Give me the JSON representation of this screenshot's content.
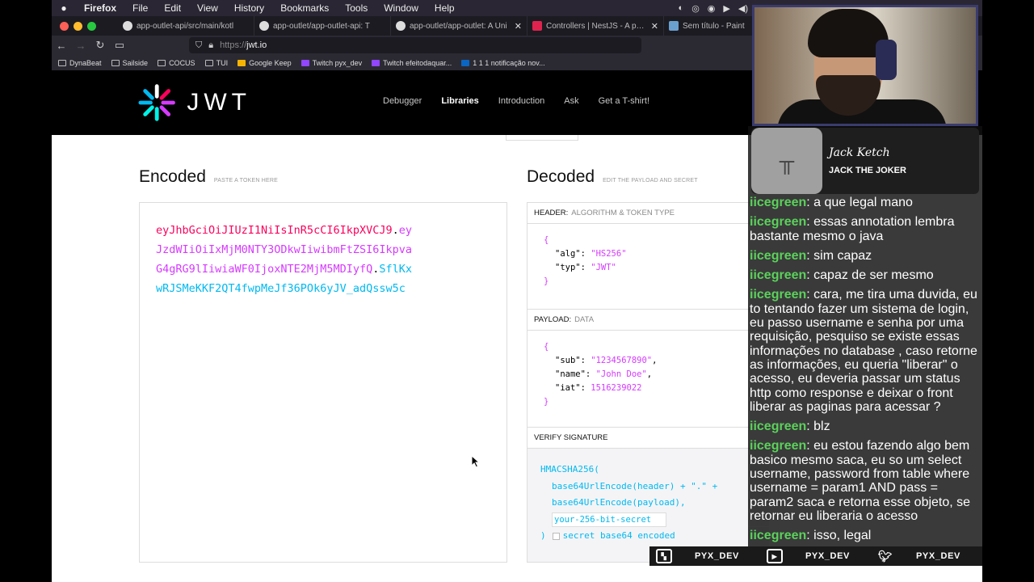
{
  "menubar": {
    "app": "Firefox",
    "items": [
      "File",
      "Edit",
      "View",
      "History",
      "Bookmarks",
      "Tools",
      "Window",
      "Help"
    ]
  },
  "tabs": [
    {
      "label": "app-outlet-api/src/main/kotl",
      "icon": "github-icon"
    },
    {
      "label": "app-outlet/app-outlet-api: T",
      "icon": "github-icon"
    },
    {
      "label": "app-outlet/app-outlet: A Uni",
      "icon": "github-icon"
    },
    {
      "label": "Controllers | NestJS - A prog",
      "icon": "nestjs-icon"
    },
    {
      "label": "Sem título - Paint",
      "icon": "paint-icon"
    }
  ],
  "address": {
    "scheme": "https://",
    "host": "jwt.io"
  },
  "bookmarks": [
    "DynaBeat",
    "Sailside",
    "COCUS",
    "TUI",
    "Google Keep",
    "Twitch pyx_dev",
    "Twitch efeitodaquar...",
    "1 1 1 notificação nov..."
  ],
  "site": {
    "logo_text": "JWT",
    "nav": [
      "Debugger",
      "Libraries",
      "Introduction",
      "Ask",
      "Get a T-shirt!"
    ],
    "active_nav": "Libraries"
  },
  "encoded": {
    "title": "Encoded",
    "hint": "PASTE A TOKEN HERE",
    "lines": [
      {
        "h": "eyJhbGciOiJIUzI1NiIsInR5cCI6IkpXVCJ9",
        "dot": ".",
        "p": "ey"
      },
      {
        "p": "JzdWIiOiIxMjM0NTY3ODkwIiwibmFtZSI6Ikpva"
      },
      {
        "p": "G4gRG9lIiwiaWF0IjoxNTE2MjM5MDIyfQ",
        "dot": ".",
        "s": "SflKx"
      },
      {
        "s": "wRJSMeKKF2QT4fwpMeJf36POk6yJV_adQssw5c"
      }
    ]
  },
  "decoded": {
    "title": "Decoded",
    "hint": "EDIT THE PAYLOAD AND SECRET",
    "header_label": "HEADER:",
    "header_sub": "ALGORITHM & TOKEN TYPE",
    "header_json": {
      "alg": "HS256",
      "typ": "JWT"
    },
    "payload_label": "PAYLOAD:",
    "payload_sub": "DATA",
    "payload_json": {
      "sub": "1234567890",
      "name": "John Doe",
      "iat": "1516239022"
    },
    "verify_label": "VERIFY SIGNATURE",
    "sig_fn": "HMACSHA256(",
    "sig_line1": "base64UrlEncode(header) + \".\" +",
    "sig_line2": "base64UrlEncode(payload),",
    "secret_value": "your-256-bit-secret",
    "sig_close": ")",
    "secret_b64_label": "secret base64 encoded"
  },
  "alert": {
    "name": "Jack Ketch",
    "subtitle": "JACK THE JOKER"
  },
  "chat": [
    {
      "user": "iicegreen",
      "text": "a que legal mano"
    },
    {
      "user": "iicegreen",
      "text": "essas annotation lembra bastante mesmo o java"
    },
    {
      "user": "iicegreen",
      "text": "sim capaz"
    },
    {
      "user": "iicegreen",
      "text": "capaz de ser mesmo"
    },
    {
      "user": "iicegreen",
      "text": "cara, me tira uma duvida, eu to tentando fazer um sistema de login, eu passo username e senha por uma requisição, pesquiso se existe essas informações no database , caso retorne as informações, eu queria \"liberar\" o acesso, eu deveria passar um status http como response e deixar o front liberar as paginas para acessar ?"
    },
    {
      "user": "iicegreen",
      "text": "blz"
    },
    {
      "user": "iicegreen",
      "text": "eu estou fazendo algo bem basico mesmo saca, eu so um select username, password from table where username = param1 AND pass = param2 saca e retorna esse objeto, se retornar eu liberaria o acesso"
    },
    {
      "user": "iicegreen",
      "text": "isso, legal"
    }
  ],
  "social": [
    {
      "icon": "twitch-icon",
      "handle": "PYX_DEV"
    },
    {
      "icon": "youtube-icon",
      "handle": "PYX_DEV"
    },
    {
      "icon": "twitter-icon",
      "handle": "PYX_DEV"
    }
  ]
}
